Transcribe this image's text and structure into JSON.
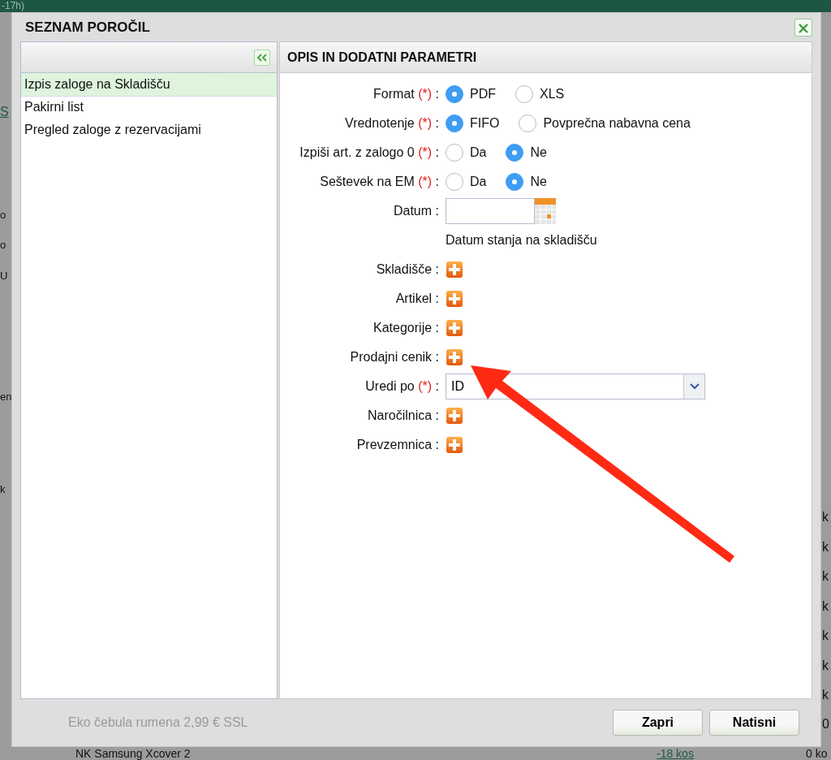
{
  "background": {
    "header_text": "-17h)",
    "link_fragment": "S",
    "left_fragments": [
      "o",
      "o",
      "U",
      "en",
      "k"
    ],
    "rows": [
      {
        "name": "Eko čebula rumena 2,99 € SSL",
        "amount": "0"
      },
      {
        "name": "NK Samsung Xcover 2",
        "amount": "0 ko",
        "stock": "-18 kos"
      }
    ],
    "right_fragments": [
      "k",
      "k",
      "k",
      "k",
      "k",
      "k",
      "k"
    ]
  },
  "dialog": {
    "title": "SEZNAM POROČIL",
    "report_list": [
      {
        "label": "Izpis zaloge na Skladišču",
        "selected": true
      },
      {
        "label": "Pakirni list",
        "selected": false
      },
      {
        "label": "Pregled zaloge z rezervacijami",
        "selected": false
      }
    ],
    "panel_title": "OPIS IN DODATNI PARAMETRI",
    "fields": [
      {
        "kind": "radio",
        "label": "Format",
        "required": true,
        "options": [
          {
            "label": "PDF",
            "selected": true
          },
          {
            "label": "XLS",
            "selected": false
          }
        ]
      },
      {
        "kind": "radio",
        "label": "Vrednotenje",
        "required": true,
        "options": [
          {
            "label": "FIFO",
            "selected": true
          },
          {
            "label": "Povprečna nabavna cena",
            "selected": false
          }
        ]
      },
      {
        "kind": "radio",
        "label": "Izpiši art. z zalogo 0",
        "required": true,
        "options": [
          {
            "label": "Da",
            "selected": false
          },
          {
            "label": "Ne",
            "selected": true
          }
        ]
      },
      {
        "kind": "radio",
        "label": "Seštevek na EM",
        "required": true,
        "options": [
          {
            "label": "Da",
            "selected": false
          },
          {
            "label": "Ne",
            "selected": true
          }
        ]
      },
      {
        "kind": "date",
        "label": "Datum",
        "required": false,
        "hint": "Datum stanja na skladišču"
      },
      {
        "kind": "add",
        "label": "Skladišče",
        "required": false
      },
      {
        "kind": "add",
        "label": "Artikel",
        "required": false
      },
      {
        "kind": "add",
        "label": "Kategorije",
        "required": false
      },
      {
        "kind": "add",
        "label": "Prodajni cenik",
        "required": false
      },
      {
        "kind": "select",
        "label": "Uredi po",
        "required": true,
        "value": "ID"
      },
      {
        "kind": "add",
        "label": "Naročilnica",
        "required": false
      },
      {
        "kind": "add",
        "label": "Prevzemnica",
        "required": false
      }
    ],
    "required_mark": "(*)",
    "separator": ":",
    "buttons": [
      "Zapri",
      "Natisni"
    ]
  }
}
